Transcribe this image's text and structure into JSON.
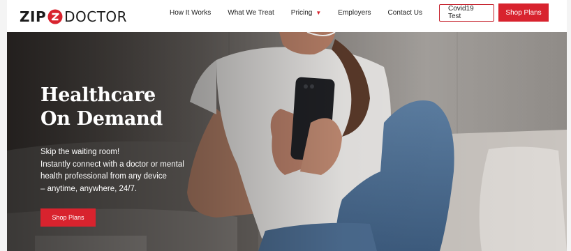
{
  "brand": {
    "logo_left": "ZIP",
    "logo_right": "DOCTOR",
    "accent": "#d8232e"
  },
  "nav": {
    "items": [
      "How It Works",
      "What We Treat",
      "Pricing",
      "Employers",
      "Contact Us"
    ],
    "pricing_caret_icon": "caret-down-icon",
    "covid_label": "Covid19 Test",
    "shop_label": "Shop Plans"
  },
  "hero": {
    "headline": [
      "Healthcare",
      "On Demand"
    ],
    "copy": [
      "Skip the waiting room!",
      "Instantly connect with a doctor or mental",
      "health professional from any device",
      "– anytime, anywhere, 24/7."
    ],
    "cta_label": "Shop Plans"
  }
}
